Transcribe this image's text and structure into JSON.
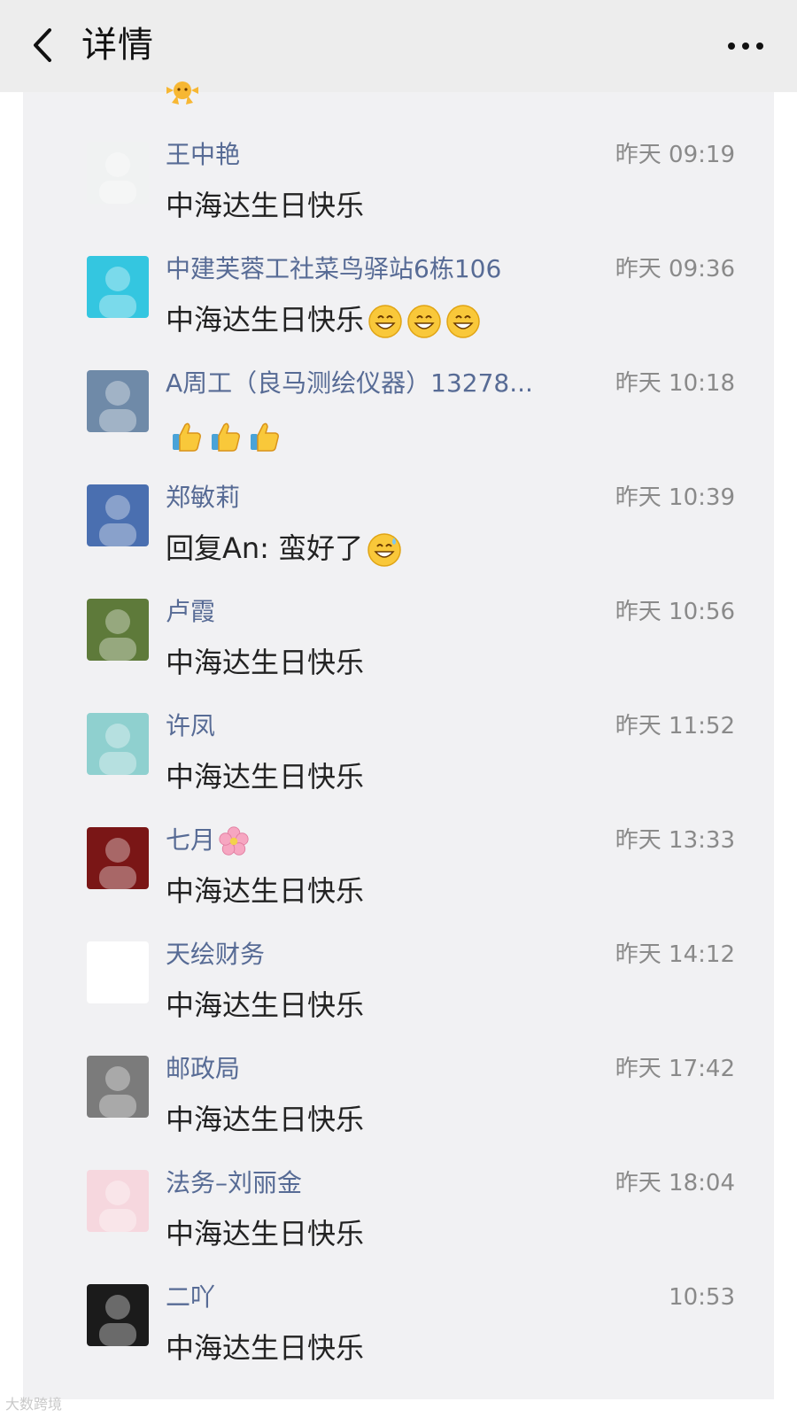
{
  "header": {
    "back_icon": "chevron-left-icon",
    "title": "详情",
    "more_icon": "more-dots-icon"
  },
  "comments": [
    {
      "name": "王中艳",
      "time": "昨天 09:19",
      "text": "中海达生日快乐",
      "avatar_color": "#f0f2f2",
      "emojis": []
    },
    {
      "name": "中建芙蓉工社菜鸟驿站6栋106",
      "time": "昨天 09:36",
      "text": "中海达生日快乐",
      "avatar_color": "#34c6e0",
      "emojis": [
        "grin",
        "grin",
        "grin"
      ]
    },
    {
      "name": "A周工（良马测绘仪器）13278...",
      "time": "昨天 10:18",
      "text": "",
      "avatar_color": "#6f8aa8",
      "emojis": [
        "thumbs-up",
        "thumbs-up",
        "thumbs-up"
      ]
    },
    {
      "name": "郑敏莉",
      "time": "昨天 10:39",
      "text": "回复An: 蛮好了",
      "avatar_color": "#4a6fb0",
      "emojis": [
        "grin-sweat"
      ]
    },
    {
      "name": "卢霞",
      "time": "昨天 10:56",
      "text": "中海达生日快乐",
      "avatar_color": "#5e7a3a",
      "emojis": []
    },
    {
      "name": "许凤",
      "time": "昨天 11:52",
      "text": "中海达生日快乐",
      "avatar_color": "#8fd0cf",
      "emojis": []
    },
    {
      "name": "七月",
      "time": "昨天 13:33",
      "text": "中海达生日快乐",
      "avatar_color": "#7a1616",
      "emojis": [],
      "name_emoji": "flower"
    },
    {
      "name": "天绘财务",
      "time": "昨天 14:12",
      "text": "中海达生日快乐",
      "avatar_color": "#ffffff",
      "emojis": []
    },
    {
      "name": "邮政局",
      "time": "昨天 17:42",
      "text": "中海达生日快乐",
      "avatar_color": "#7b7b7b",
      "emojis": []
    },
    {
      "name": "法务–刘丽金",
      "time": "昨天 18:04",
      "text": "中海达生日快乐",
      "avatar_color": "#f6d7de",
      "emojis": []
    },
    {
      "name": "二吖",
      "time": "10:53",
      "text": "中海达生日快乐",
      "avatar_color": "#1b1b1b",
      "emojis": []
    }
  ],
  "watermark": "大数跨境",
  "colors": {
    "name_link": "#576b95",
    "time": "#8a8a8a",
    "panel_bg": "#f1f1f3",
    "header_bg": "#ededed"
  }
}
